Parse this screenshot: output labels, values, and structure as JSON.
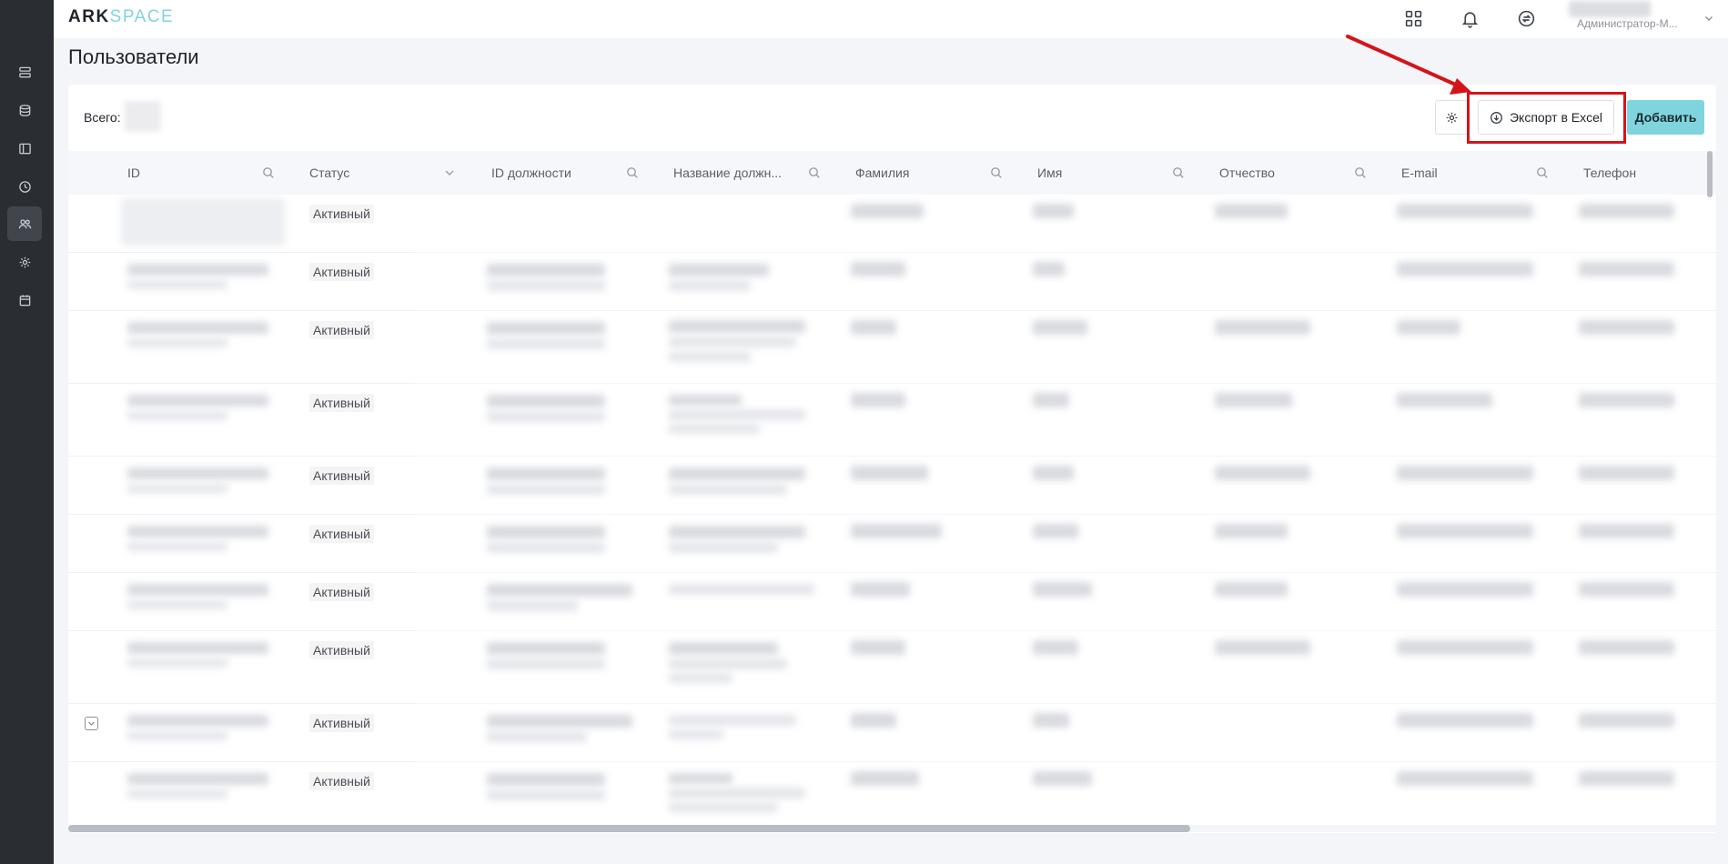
{
  "app": {
    "logo_primary": "ARK",
    "logo_secondary": "SPACE"
  },
  "sidebar": {
    "items": [
      {
        "name": "list-icon",
        "active": false
      },
      {
        "name": "database-icon",
        "active": false
      },
      {
        "name": "book-icon",
        "active": false
      },
      {
        "name": "clock-icon",
        "active": false
      },
      {
        "name": "users-icon",
        "active": true
      },
      {
        "name": "gear-icon",
        "active": false
      },
      {
        "name": "calendar-icon",
        "active": false
      }
    ]
  },
  "header": {
    "icons": [
      "apps-grid-icon",
      "bell-icon",
      "sync-icon"
    ],
    "user_name": "Администратор-М..."
  },
  "page": {
    "title": "Пользователи"
  },
  "toolbar": {
    "total_label": "Всего:",
    "export_label": "Экспорт в Excel",
    "add_label": "Добавить"
  },
  "table": {
    "columns": [
      {
        "label": "ID",
        "control": "search"
      },
      {
        "label": "Статус",
        "control": "dropdown"
      },
      {
        "label": "ID должности",
        "control": "search"
      },
      {
        "label": "Название должн...",
        "control": "search"
      },
      {
        "label": "Фамилия",
        "control": "search"
      },
      {
        "label": "Имя",
        "control": "search"
      },
      {
        "label": "Отчество",
        "control": "search"
      },
      {
        "label": "E-mail",
        "control": "search"
      },
      {
        "label": "Телефон",
        "control": "none"
      }
    ],
    "rows": [
      {
        "status": "Активный"
      },
      {
        "status": "Активный"
      },
      {
        "status": "Активный"
      },
      {
        "status": "Активный"
      },
      {
        "status": "Активный"
      },
      {
        "status": "Активный"
      },
      {
        "status": "Активный"
      },
      {
        "status": "Активный"
      },
      {
        "status": "Активный"
      },
      {
        "status": "Активный"
      }
    ]
  },
  "colors": {
    "accent": "#80d4de",
    "sidebar": "#2a2d32",
    "highlight": "#d3141b"
  }
}
